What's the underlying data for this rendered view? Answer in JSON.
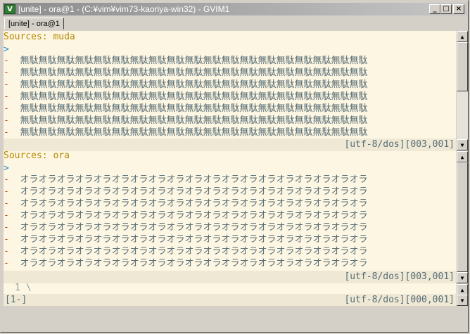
{
  "window": {
    "title": "[unite] - ora@1 - (C:¥vim¥vim73-kaoriya-win32) - GVIM1",
    "app_icon": "vim-icon",
    "buttons": {
      "minimize": "_",
      "maximize": "□",
      "close": "×"
    }
  },
  "tabs": [
    {
      "label": "[unite] - ora@1"
    }
  ],
  "pane1": {
    "header_label": "Sources:",
    "source_name": "muda",
    "prompt": ">",
    "rows": [
      "無駄無駄無駄無駄無駄無駄無駄無駄無駄無駄無駄無駄無駄無駄無駄無駄無駄無駄無駄",
      "無駄無駄無駄無駄無駄無駄無駄無駄無駄無駄無駄無駄無駄無駄無駄無駄無駄無駄無駄",
      "無駄無駄無駄無駄無駄無駄無駄無駄無駄無駄無駄無駄無駄無駄無駄無駄無駄無駄無駄",
      "無駄無駄無駄無駄無駄無駄無駄無駄無駄無駄無駄無駄無駄無駄無駄無駄無駄無駄無駄",
      "無駄無駄無駄無駄無駄無駄無駄無駄無駄無駄無駄無駄無駄無駄無駄無駄無駄無駄無駄",
      "無駄無駄無駄無駄無駄無駄無駄無駄無駄無駄無駄無駄無駄無駄無駄無駄無駄無駄無駄",
      "無駄無駄無駄無駄無駄無駄無駄無駄無駄無駄無駄無駄無駄無駄無駄無駄無駄無駄無駄"
    ],
    "status_right": "[utf-8/dos][003,001]"
  },
  "pane2": {
    "header_label": "Sources:",
    "source_name": "ora",
    "prompt": ">",
    "rows": [
      "オラオラオラオラオラオラオラオラオラオラオラオラオラオラオラオラオラオラオラ",
      "オラオラオラオラオラオラオラオラオラオラオラオラオラオラオラオラオラオラオラ",
      "オラオラオラオラオラオラオラオラオラオラオラオラオラオラオラオラオラオラオラ",
      "オラオラオラオラオラオラオラオラオラオラオラオラオラオラオラオラオラオラオラ",
      "オラオラオラオラオラオラオラオラオラオラオラオラオラオラオラオラオラオラオラ",
      "オラオラオラオラオラオラオラオラオラオラオラオラオラオラオラオラオラオラオラ",
      "オラオラオラオラオラオラオラオラオラオラオラオラオラオラオラオラオラオラオラ",
      "オラオラオラオラオラオラオラオラオラオラオラオラオラオラオラオラオラオラオラ"
    ],
    "status_right": "[utf-8/dos][003,001]"
  },
  "pane3": {
    "line_number": "1",
    "content": "\\",
    "status_left": "[1-]",
    "status_right": "[utf-8/dos][000,001]"
  },
  "colors": {
    "background": "#fdf6e3",
    "status_bg": "#eee8d5",
    "header": "#b58900",
    "prompt": "#268bd2",
    "dash": "#cb4b16",
    "text": "#586e75"
  }
}
